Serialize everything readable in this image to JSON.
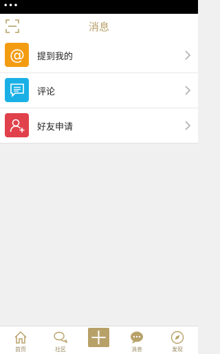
{
  "status_bar": {
    "dots": "•••",
    "carrier": ""
  },
  "header": {
    "title": "消息"
  },
  "rows": [
    {
      "label": "提到我的",
      "icon": "at-icon",
      "color": "#f39c12"
    },
    {
      "label": "评论",
      "icon": "comment-icon",
      "color": "#1ab0e6"
    },
    {
      "label": "好友申请",
      "icon": "add-friend-icon",
      "color": "#e0414b"
    }
  ],
  "tabs": [
    {
      "label": "首页",
      "icon": "home-icon"
    },
    {
      "label": "社区",
      "icon": "community-icon"
    },
    {
      "label": "",
      "icon": "plus-icon"
    },
    {
      "label": "消息",
      "icon": "message-icon"
    },
    {
      "label": "发现",
      "icon": "compass-icon"
    }
  ],
  "colors": {
    "accent": "#b8a169"
  }
}
